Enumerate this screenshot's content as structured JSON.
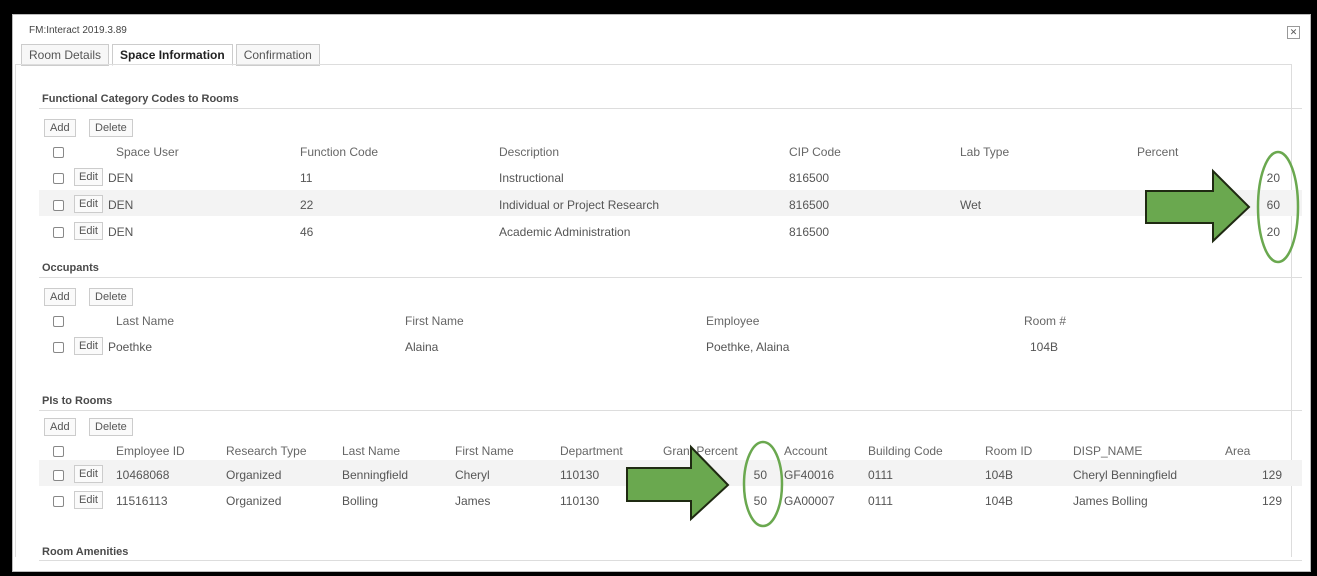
{
  "window": {
    "title": "FM:Interact 2019.3.89",
    "close_icon": "close-icon"
  },
  "tabs": [
    "Room Details",
    "Space Information",
    "Confirmation"
  ],
  "sections": {
    "functional": {
      "title": "Functional Category Codes to Rooms",
      "add_label": "Add",
      "delete_label": "Delete",
      "columns": [
        "Space User",
        "Function Code",
        "Description",
        "CIP Code",
        "Lab Type",
        "Percent"
      ],
      "rows": [
        {
          "space_user": "DEN",
          "function_code": "11",
          "description": "Instructional",
          "cip_code": "816500",
          "lab_type": "",
          "percent": "20"
        },
        {
          "space_user": "DEN",
          "function_code": "22",
          "description": "Individual or Project Research",
          "cip_code": "816500",
          "lab_type": "Wet",
          "percent": "60"
        },
        {
          "space_user": "DEN",
          "function_code": "46",
          "description": "Academic Administration",
          "cip_code": "816500",
          "lab_type": "",
          "percent": "20"
        }
      ]
    },
    "occupants": {
      "title": "Occupants",
      "add_label": "Add",
      "delete_label": "Delete",
      "columns": [
        "Last Name",
        "First Name",
        "Employee",
        "Room #"
      ],
      "rows": [
        {
          "last_name": "Poethke",
          "first_name": "Alaina",
          "employee": "Poethke, Alaina",
          "room": "104B"
        }
      ]
    },
    "pis": {
      "title": "PIs to Rooms",
      "add_label": "Add",
      "delete_label": "Delete",
      "columns": [
        "Employee ID",
        "Research Type",
        "Last Name",
        "First Name",
        "Department",
        "Grant Percent",
        "Account",
        "Building Code",
        "Room ID",
        "DISP_NAME",
        "Area"
      ],
      "rows": [
        {
          "employee_id": "10468068",
          "research_type": "Organized",
          "last_name": "Benningfield",
          "first_name": "Cheryl",
          "department": "110130",
          "grant_percent": "50",
          "account": "GF40016",
          "building_code": "0111",
          "room_id": "104B",
          "disp_name": "Cheryl Benningfield",
          "area": "129"
        },
        {
          "employee_id": "11516113",
          "research_type": "Organized",
          "last_name": "Bolling",
          "first_name": "James",
          "department": "110130",
          "grant_percent": "50",
          "account": "GA00007",
          "building_code": "0111",
          "room_id": "104B",
          "disp_name": "James Bolling",
          "area": "129"
        }
      ]
    },
    "amenities": {
      "title": "Room Amenities"
    }
  },
  "edit_label": "Edit",
  "annotation_color": "#6aa84f",
  "annotation_outline": "#1f2a12"
}
